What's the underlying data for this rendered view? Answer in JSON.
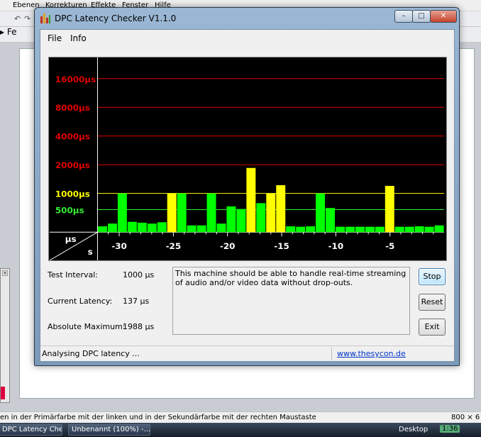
{
  "background_app": {
    "menu": [
      "Ebenen",
      "Korrekturen",
      "Effekte",
      "Fenster",
      "Hilfe"
    ],
    "toolbar_fragment": "Fe",
    "status_message": "en in der Primärfarbe mit der linken und in der Sekundärfarbe mit der rechten Maustaste",
    "image_size": "800 × 6"
  },
  "taskbar": {
    "items": [
      "DPC Latency Check...",
      "Unbenannt (100%) -..."
    ],
    "desktop_label": "Desktop",
    "clock": "1:36"
  },
  "window": {
    "title": "DPC Latency Checker V1.1.0",
    "menu": {
      "file": "File",
      "info": "Info"
    },
    "controls": {
      "minimize": "–",
      "maximize": "□",
      "close": "✕"
    }
  },
  "chart_data": {
    "type": "bar",
    "x_unit_label": "s",
    "y_unit_label": "µs",
    "y_levels": [
      {
        "label": "16000µs",
        "value": 16000,
        "color": "#e00000"
      },
      {
        "label": "8000µs",
        "value": 8000,
        "color": "#e00000"
      },
      {
        "label": "4000µs",
        "value": 4000,
        "color": "#e00000"
      },
      {
        "label": "2000µs",
        "value": 2000,
        "color": "#e00000"
      },
      {
        "label": "1000µs",
        "value": 1000,
        "color": "#ffff00"
      },
      {
        "label": "500µs",
        "value": 500,
        "color": "#33ee33"
      }
    ],
    "x_ticks": [
      {
        "label": "-30",
        "value": -30
      },
      {
        "label": "-25",
        "value": -25
      },
      {
        "label": "-20",
        "value": -20
      },
      {
        "label": "-15",
        "value": -15
      },
      {
        "label": "-10",
        "value": -10
      },
      {
        "label": "-5",
        "value": -5
      }
    ],
    "x_range": [
      -32,
      0
    ],
    "values": [
      130,
      190,
      1000,
      230,
      210,
      190,
      220,
      1000,
      1000,
      150,
      150,
      1000,
      190,
      600,
      520,
      1850,
      700,
      1000,
      1220,
      130,
      120,
      130,
      1000,
      550,
      120,
      120,
      120,
      120,
      120,
      1200,
      120,
      120,
      130,
      120,
      150
    ],
    "bar_colors": {
      "normal": "#00ff00",
      "warning": "#ffff00"
    },
    "background": "#000000"
  },
  "info": {
    "test_interval_label": "Test Interval:",
    "test_interval_value": "1000 µs",
    "current_latency_label": "Current Latency:",
    "current_latency_value": "137 µs",
    "absolute_maximum_label": "Absolute Maximum:",
    "absolute_maximum_value": "1988 µs",
    "message": "This machine should be able to handle real-time streaming of audio and/or video data without drop-outs."
  },
  "buttons": {
    "stop": "Stop",
    "reset": "Reset",
    "exit": "Exit"
  },
  "status": {
    "text": "Analysing DPC latency ...",
    "link": "www.thesycon.de"
  }
}
